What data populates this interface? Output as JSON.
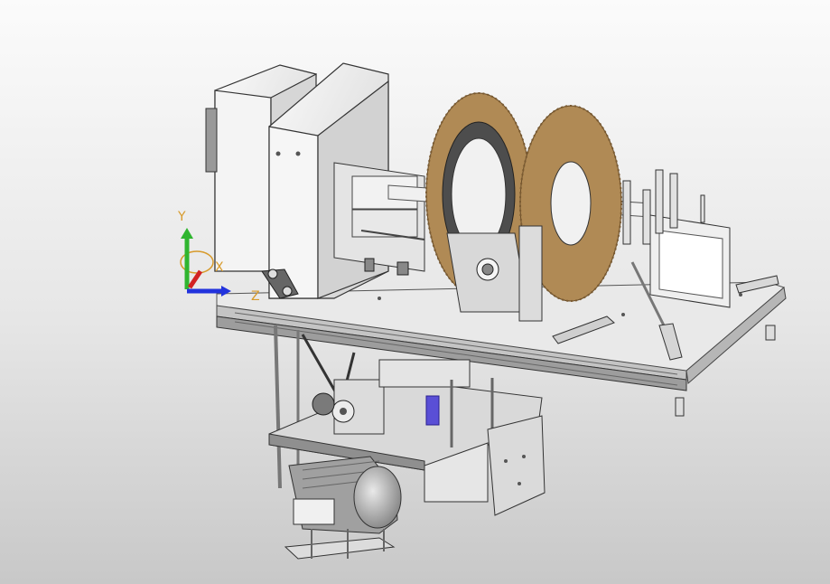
{
  "view": {
    "background_top": "#fbfbfb",
    "background_bottom": "#c8c8c8",
    "metal_light": "#f2f2f2",
    "metal_mid": "#c9c9c9",
    "metal_dark": "#555555",
    "brush_color": "#b08a55",
    "motor_color": "#9a9a9a",
    "spring_color": "#5a4fd6"
  },
  "triad": {
    "y_label": "Y",
    "z_label": "Z",
    "x_label": "X",
    "y_color": "#2fb52f",
    "z_color": "#2233dd",
    "x_color": "#d22222",
    "ring_color": "#d79a2b"
  }
}
